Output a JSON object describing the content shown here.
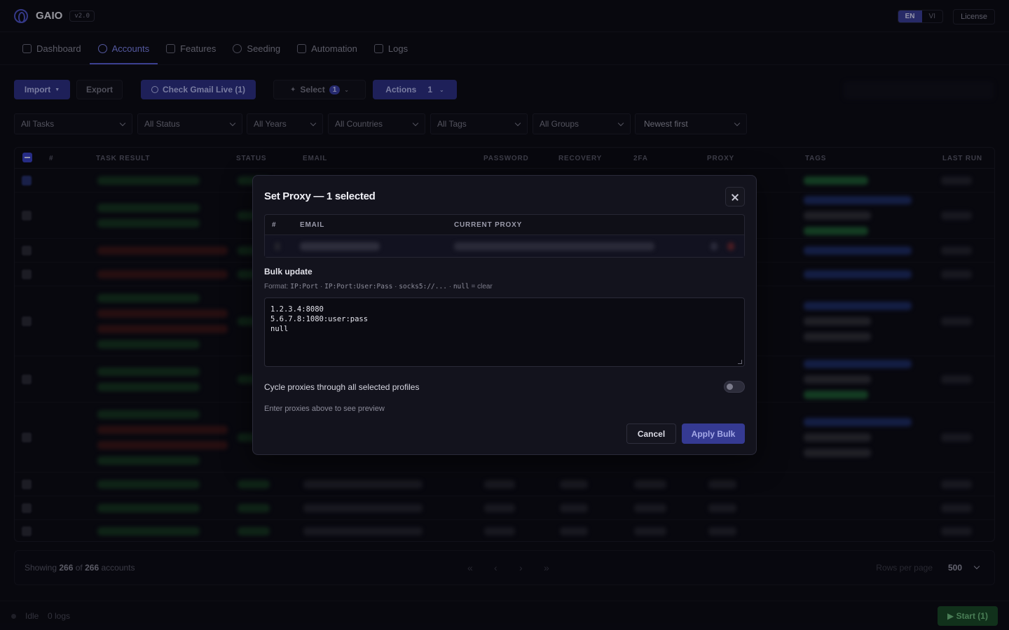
{
  "app": {
    "name": "GAIO",
    "version": "v2.0"
  },
  "lang": {
    "en": "EN",
    "vi": "VI",
    "active": "EN"
  },
  "license_label": "License",
  "nav": [
    {
      "label": "Dashboard",
      "icon": "dashboard-icon"
    },
    {
      "label": "Accounts",
      "icon": "users-icon",
      "active": true
    },
    {
      "label": "Features",
      "icon": "sliders-icon"
    },
    {
      "label": "Seeding",
      "icon": "target-icon"
    },
    {
      "label": "Automation",
      "icon": "bolt-icon"
    },
    {
      "label": "Logs",
      "icon": "logs-icon"
    }
  ],
  "toolbar": {
    "import": "Import",
    "export": "Export",
    "check_gmail": "Check Gmail Live (1)",
    "select": "Select",
    "select_count": "1",
    "actions": "Actions",
    "actions_count": "1"
  },
  "filters": {
    "tasks": "All Tasks",
    "status": "All Status",
    "years": "All Years",
    "countries": "All Countries",
    "tags": "All Tags",
    "groups": "All Groups",
    "sort": "Newest first"
  },
  "table": {
    "columns": [
      "#",
      "TASK RESULT",
      "STATUS",
      "EMAIL",
      "PASSWORD",
      "RECOVERY",
      "2FA",
      "PROXY",
      "TAGS",
      "LAST RUN"
    ]
  },
  "pagination": {
    "showing_prefix": "Showing",
    "shown": "266",
    "of": "of",
    "total": "266",
    "suffix": "accounts",
    "rows_per_page_label": "Rows per page",
    "rows_per_page": "500",
    "first": "«",
    "prev": "‹",
    "next": "›",
    "last": "»"
  },
  "status_bar": {
    "state": "Idle",
    "logs": "0 logs",
    "start": "▶ Start (1)"
  },
  "modal": {
    "title": "Set Proxy — 1 selected",
    "table_columns": {
      "num": "#",
      "email": "EMAIL",
      "current_proxy": "CURRENT PROXY"
    },
    "bulk_label": "Bulk update",
    "format_prefix": "Format:",
    "format_1": "IP:Port",
    "format_2": "IP:Port:User:Pass",
    "format_3": "socks5://...",
    "format_4": "null",
    "format_suffix": "= clear",
    "proxy_text": "1.2.3.4:8080\n5.6.7.8:1080:user:pass\nnull",
    "cycle_label": "Cycle proxies through all selected profiles",
    "cycle_enabled": false,
    "preview_note": "Enter proxies above to see preview",
    "cancel": "Cancel",
    "apply": "Apply Bulk"
  },
  "colors": {
    "accent": "#3b3f9a",
    "primary_button": "#2d3185",
    "start_green": "#1a4a26"
  }
}
